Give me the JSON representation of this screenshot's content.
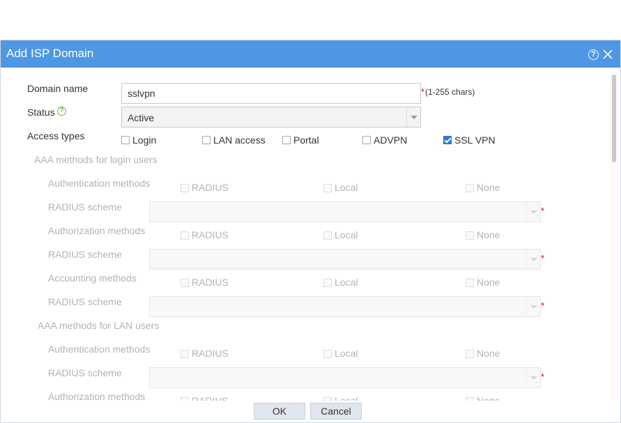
{
  "dialog": {
    "title": "Add ISP Domain",
    "help_icon": "help-icon",
    "close_icon": "close-icon"
  },
  "form": {
    "domain_name": {
      "label": "Domain name",
      "value": "sslvpn",
      "required_mark": "*",
      "hint": "(1-255 chars)"
    },
    "status": {
      "label": "Status",
      "help_icon": "question-icon",
      "value": "Active"
    },
    "access_types": {
      "label": "Access types",
      "options": [
        {
          "label": "Login",
          "checked": false
        },
        {
          "label": "LAN access",
          "checked": false
        },
        {
          "label": "Portal",
          "checked": false
        },
        {
          "label": "ADVPN",
          "checked": false
        },
        {
          "label": "SSL VPN",
          "checked": true
        }
      ]
    }
  },
  "login_users": {
    "heading": "AAA methods for login users",
    "authentication_label": "Authentication methods",
    "authorization_label": "Authorization methods",
    "accounting_label": "Accounting methods",
    "radius_scheme_label": "RADIUS scheme",
    "method_options": [
      "RADIUS",
      "Local",
      "None"
    ],
    "required_mark": "*"
  },
  "lan_users": {
    "heading": "AAA methods for LAN users",
    "authentication_label": "Authentication methods",
    "authorization_label": "Authorization methods",
    "radius_scheme_label": "RADIUS scheme",
    "method_options": [
      "RADIUS",
      "Local",
      "None"
    ],
    "required_mark": "*"
  },
  "buttons": {
    "ok": "OK",
    "cancel": "Cancel"
  },
  "colors": {
    "titlebar": "#4f97e3",
    "checkbox_checked": "#2b79d6",
    "required": "#ee0000",
    "help_green": "#6abf2a"
  }
}
